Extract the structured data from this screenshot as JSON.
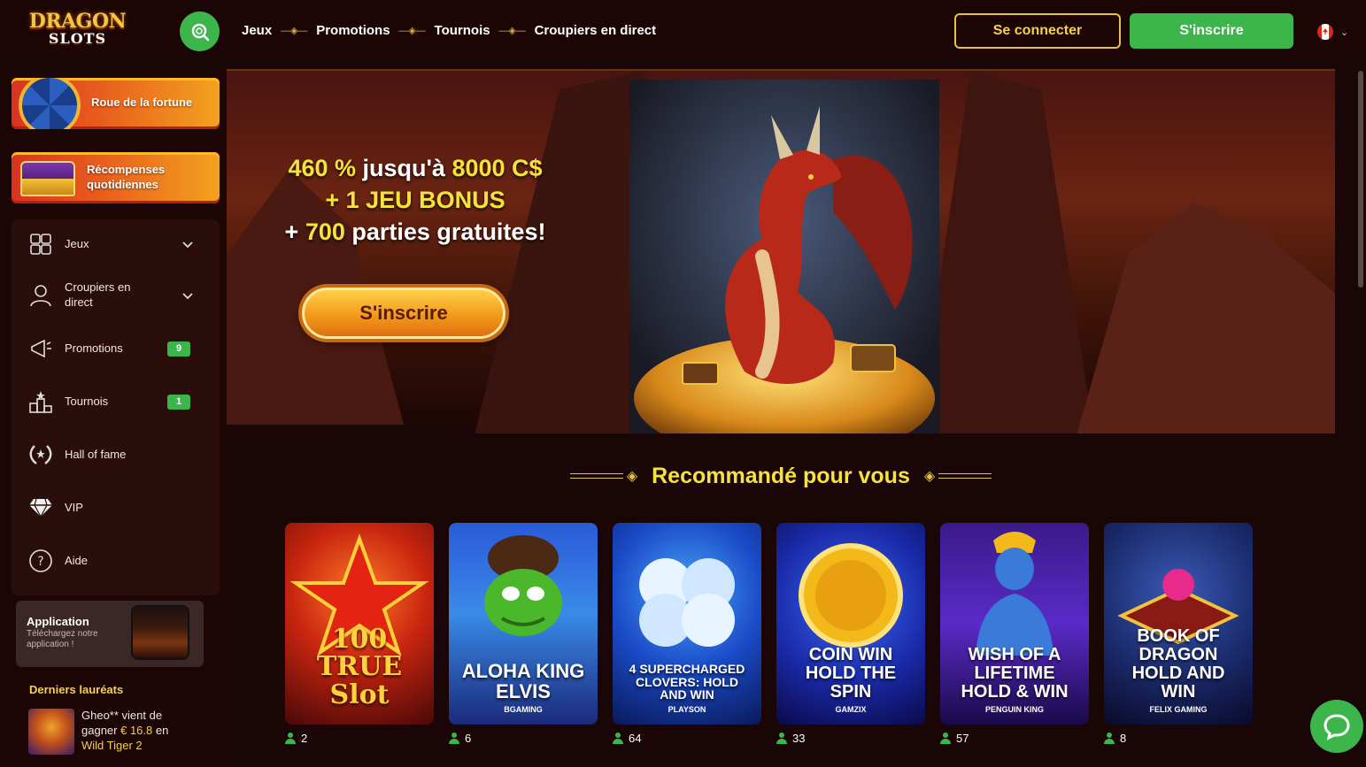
{
  "header": {
    "logo_line1": "DRAGON",
    "logo_line2": "SLOTS",
    "nav": [
      "Jeux",
      "Promotions",
      "Tournois",
      "Croupiers en direct"
    ],
    "login_label": "Se connecter",
    "signup_label": "S'inscrire"
  },
  "sidebar": {
    "wheel_label": "Roue de la fortune",
    "rewards_label": "Récompenses quotidiennes",
    "items": [
      {
        "label": "Jeux",
        "icon": "puzzle-icon"
      },
      {
        "label": "Croupiers en direct",
        "icon": "dealer-icon"
      },
      {
        "label": "Promotions",
        "icon": "megaphone-icon",
        "badge": "9"
      },
      {
        "label": "Tournois",
        "icon": "podium-icon",
        "badge": "1"
      },
      {
        "label": "Hall of fame",
        "icon": "laurel-icon"
      },
      {
        "label": "VIP",
        "icon": "diamond-icon"
      },
      {
        "label": "Aide",
        "icon": "help-icon"
      }
    ],
    "app": {
      "title": "Application",
      "subtitle": "Téléchargez notre application !"
    },
    "winners_title": "Derniers lauréats",
    "winner": {
      "name": "Gheo**",
      "text1": "vient de gagner",
      "amount": "€ 16.8",
      "text2": "en",
      "game": "Wild Tiger 2"
    }
  },
  "hero": {
    "line1_a": "460 %",
    "line1_b": " jusqu'à ",
    "line1_c": "8000 C$",
    "line2": "+ 1 JEU BONUS",
    "line3_a": "+ ",
    "line3_b": "700",
    "line3_c": " parties gratuites!",
    "cta": "S'inscrire"
  },
  "section_title": "Recommandé pour vous",
  "games": [
    {
      "title": "100 TRUE Slot",
      "provider": "",
      "players": "2"
    },
    {
      "title": "ALOHA KING ELVIS",
      "provider": "BGAMING",
      "players": "6"
    },
    {
      "title": "4 SUPERCHARGED CLOVERS: HOLD AND WIN",
      "provider": "PLAYSON",
      "players": "64"
    },
    {
      "title": "COIN WIN HOLD THE SPIN",
      "provider": "GAMZIX",
      "players": "33"
    },
    {
      "title": "WISH OF A LIFETIME HOLD & WIN",
      "provider": "PENGUIN KING",
      "players": "57"
    },
    {
      "title": "BOOK OF DRAGON HOLD AND WIN",
      "provider": "FELIX GAMING",
      "players": "8"
    }
  ]
}
